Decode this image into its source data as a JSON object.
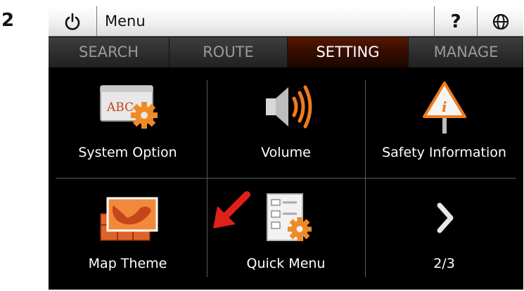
{
  "step_number": "2",
  "titlebar": {
    "title": "Menu",
    "help_label": "?",
    "power_icon": "power-icon",
    "globe_icon": "globe-icon"
  },
  "tabs": [
    {
      "label": "SEARCH",
      "active": false
    },
    {
      "label": "ROUTE",
      "active": false
    },
    {
      "label": "SETTING",
      "active": true
    },
    {
      "label": "MANAGE",
      "active": false
    }
  ],
  "menu": {
    "items": [
      {
        "label": "System Option",
        "icon": "system-option-icon"
      },
      {
        "label": "Volume",
        "icon": "volume-icon"
      },
      {
        "label": "Safety Information",
        "icon": "safety-warning-icon"
      },
      {
        "label": "Map Theme",
        "icon": "map-theme-icon"
      },
      {
        "label": "Quick Menu",
        "icon": "quick-menu-icon"
      },
      {
        "label": "2/3",
        "icon": "next-page-chevron-icon"
      }
    ],
    "system_option_icon_text": "ABC"
  },
  "colors": {
    "accent_orange": "#f07a1c",
    "annotation_arrow": "#e0201a",
    "background": "#000000"
  }
}
